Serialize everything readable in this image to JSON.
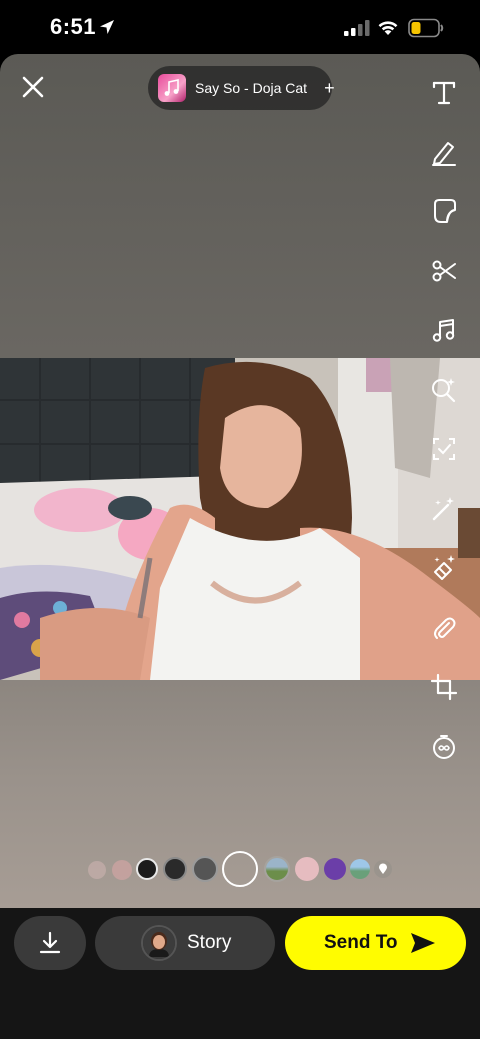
{
  "status_bar": {
    "time": "6:51",
    "location_icon": "location-arrow-icon",
    "signal_icon": "cellular-signal-icon",
    "wifi_icon": "wifi-icon",
    "battery_icon": "battery-low-icon",
    "battery_color": "#f5c400"
  },
  "editor": {
    "close_icon": "close-icon",
    "music": {
      "title": "Say So - Doja Cat",
      "add_label": "+"
    },
    "tools": [
      {
        "name": "text-tool",
        "icon": "text-t-icon"
      },
      {
        "name": "draw-tool",
        "icon": "pencil-icon"
      },
      {
        "name": "sticker-tool",
        "icon": "sticker-icon"
      },
      {
        "name": "scissors-tool",
        "icon": "scissors-icon"
      },
      {
        "name": "music-tool",
        "icon": "music-note-icon"
      },
      {
        "name": "lens-tool",
        "icon": "lens-search-sparkle-icon"
      },
      {
        "name": "scan-tool",
        "icon": "scan-icon"
      },
      {
        "name": "magic-tool",
        "icon": "magic-wand-icon"
      },
      {
        "name": "eraser-tool",
        "icon": "magic-eraser-icon"
      },
      {
        "name": "link-tool",
        "icon": "paperclip-icon"
      },
      {
        "name": "crop-tool",
        "icon": "crop-icon"
      },
      {
        "name": "timer-tool",
        "icon": "infinity-timer-icon"
      }
    ],
    "filters": {
      "count": 13,
      "selected_index": 5
    }
  },
  "bottom_bar": {
    "download_icon": "download-icon",
    "story_label": "Story",
    "send_label": "Send To",
    "send_color": "#fffc00"
  }
}
